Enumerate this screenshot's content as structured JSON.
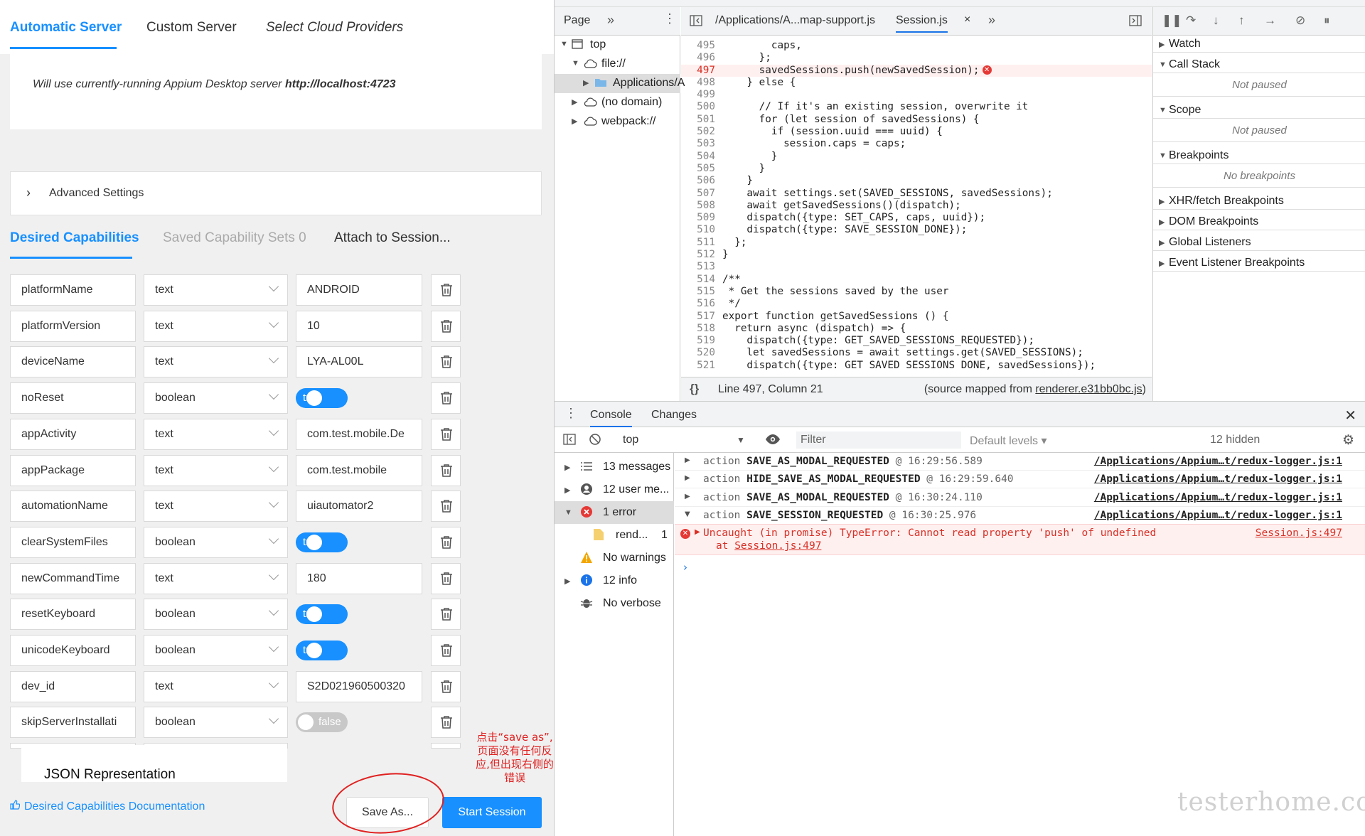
{
  "appium": {
    "server_tabs": [
      "Automatic Server",
      "Custom Server",
      "Select Cloud Providers"
    ],
    "server_note_prefix": "Will use currently-running Appium Desktop server ",
    "server_note_url": "http://localhost:4723",
    "advanced_settings_label": "Advanced Settings",
    "cap_tabs": [
      "Desired Capabilities",
      "Saved Capability Sets 0",
      "Attach to Session..."
    ],
    "capabilities": [
      {
        "name": "platformName",
        "type": "text",
        "value": "ANDROID"
      },
      {
        "name": "platformVersion",
        "type": "text",
        "value": "10"
      },
      {
        "name": "deviceName",
        "type": "text",
        "value": "LYA-AL00L"
      },
      {
        "name": "noReset",
        "type": "boolean",
        "value": "true"
      },
      {
        "name": "appActivity",
        "type": "text",
        "value": "com.test.mobile.De"
      },
      {
        "name": "appPackage",
        "type": "text",
        "value": "com.test.mobile"
      },
      {
        "name": "automationName",
        "type": "text",
        "value": "uiautomator2"
      },
      {
        "name": "clearSystemFiles",
        "type": "boolean",
        "value": "true"
      },
      {
        "name": "newCommandTime",
        "type": "text",
        "value": "180"
      },
      {
        "name": "resetKeyboard",
        "type": "boolean",
        "value": "true"
      },
      {
        "name": "unicodeKeyboard",
        "type": "boolean",
        "value": "true"
      },
      {
        "name": "dev_id",
        "type": "text",
        "value": "S2D021960500320"
      },
      {
        "name": "skipServerInstallati",
        "type": "boolean",
        "value": "false"
      }
    ],
    "json_representation_label": "JSON Representation",
    "docs_link_label": "Desired Capabilities Documentation",
    "save_as_label": "Save As...",
    "start_session_label": "Start Session",
    "annotation_text": "点击“save as”,页面没有任何反应,但出现右侧的错误",
    "accent_color": "#1890ff",
    "annotation_color": "#e02020"
  },
  "devtools": {
    "navigator": {
      "tab_label": "Page",
      "tree": [
        {
          "label": "top",
          "depth": 0,
          "expanded": true,
          "icon": "frame-icon"
        },
        {
          "label": "file://",
          "depth": 1,
          "expanded": true,
          "icon": "cloud-icon"
        },
        {
          "label": "Applications/A",
          "depth": 2,
          "expanded": false,
          "icon": "folder-icon",
          "selected": true
        },
        {
          "label": "(no domain)",
          "depth": 1,
          "expanded": false,
          "icon": "cloud-icon"
        },
        {
          "label": "webpack://",
          "depth": 1,
          "expanded": false,
          "icon": "cloud-icon"
        }
      ]
    },
    "editor": {
      "tabs": [
        "/Applications/A...map-support.js",
        "Session.js"
      ],
      "lines": [
        {
          "n": "495",
          "t": "        caps,"
        },
        {
          "n": "496",
          "t": "      };"
        },
        {
          "n": "497",
          "t": "      savedSessions.push(newSavedSession);",
          "error": true
        },
        {
          "n": "498",
          "t": "    } else {"
        },
        {
          "n": "499",
          "t": ""
        },
        {
          "n": "500",
          "t": "      // If it's an existing session, overwrite it"
        },
        {
          "n": "501",
          "t": "      for (let session of savedSessions) {"
        },
        {
          "n": "502",
          "t": "        if (session.uuid === uuid) {"
        },
        {
          "n": "503",
          "t": "          session.caps = caps;"
        },
        {
          "n": "504",
          "t": "        }"
        },
        {
          "n": "505",
          "t": "      }"
        },
        {
          "n": "506",
          "t": "    }"
        },
        {
          "n": "507",
          "t": "    await settings.set(SAVED_SESSIONS, savedSessions);"
        },
        {
          "n": "508",
          "t": "    await getSavedSessions()(dispatch);"
        },
        {
          "n": "509",
          "t": "    dispatch({type: SET_CAPS, caps, uuid});"
        },
        {
          "n": "510",
          "t": "    dispatch({type: SAVE_SESSION_DONE});"
        },
        {
          "n": "511",
          "t": "  };"
        },
        {
          "n": "512",
          "t": "}"
        },
        {
          "n": "513",
          "t": ""
        },
        {
          "n": "514",
          "t": "/**"
        },
        {
          "n": "515",
          "t": " * Get the sessions saved by the user"
        },
        {
          "n": "516",
          "t": " */"
        },
        {
          "n": "517",
          "t": "export function getSavedSessions () {"
        },
        {
          "n": "518",
          "t": "  return async (dispatch) => {"
        },
        {
          "n": "519",
          "t": "    dispatch({type: GET_SAVED_SESSIONS_REQUESTED});"
        },
        {
          "n": "520",
          "t": "    let savedSessions = await settings.get(SAVED_SESSIONS);"
        },
        {
          "n": "521",
          "t": "    dispatch({type: GET_SAVED_SESSIONS_DONE, savedSessions});"
        }
      ],
      "status_position": "Line 497, Column 21",
      "source_map_prefix": "(source mapped from ",
      "source_map_file": "renderer.e31bb0bc.js",
      "source_map_suffix": ")"
    },
    "debugger": {
      "panes": [
        {
          "label": "Watch",
          "expanded": false
        },
        {
          "label": "Call Stack",
          "expanded": true,
          "body": "Not paused"
        },
        {
          "label": "Scope",
          "expanded": true,
          "body": "Not paused"
        },
        {
          "label": "Breakpoints",
          "expanded": true,
          "body": "No breakpoints"
        },
        {
          "label": "XHR/fetch Breakpoints",
          "expanded": false
        },
        {
          "label": "DOM Breakpoints",
          "expanded": false
        },
        {
          "label": "Global Listeners",
          "expanded": false
        },
        {
          "label": "Event Listener Breakpoints",
          "expanded": false
        }
      ]
    },
    "drawer": {
      "tabs": [
        "Console",
        "Changes"
      ],
      "context": "top",
      "filter_placeholder": "Filter",
      "levels_label": "Default levels ▾",
      "hidden_label": "12 hidden",
      "sidebar": [
        {
          "label": "13 messages",
          "icon": "list-icon",
          "expandable": true
        },
        {
          "label": "12 user me...",
          "icon": "user-icon",
          "expandable": true
        },
        {
          "label": "1 error",
          "icon": "error-icon",
          "expandable": true,
          "selected": true,
          "expanded": true
        },
        {
          "label": "rend...",
          "count": "1",
          "icon": "file-icon",
          "child": true
        },
        {
          "label": "No warnings",
          "icon": "warning-icon",
          "expandable": false
        },
        {
          "label": "12 info",
          "icon": "info-icon",
          "expandable": true
        },
        {
          "label": "No verbose",
          "icon": "bug-icon",
          "expandable": false
        }
      ],
      "messages": [
        {
          "action": "SAVE_AS_MODAL_REQUESTED",
          "time": "16:29:56.589",
          "source": "/Applications/Appium…t/redux-logger.js:1"
        },
        {
          "action": "HIDE_SAVE_AS_MODAL_REQUESTED",
          "time": "16:29:59.640",
          "source": "/Applications/Appium…t/redux-logger.js:1"
        },
        {
          "action": "SAVE_AS_MODAL_REQUESTED",
          "time": "16:30:24.110",
          "source": "/Applications/Appium…t/redux-logger.js:1"
        },
        {
          "action": "SAVE_SESSION_REQUESTED",
          "time": "16:30:25.976",
          "source": "/Applications/Appium…t/redux-logger.js:1",
          "expanded": true
        }
      ],
      "action_word": "action",
      "at_sign": "@",
      "error": {
        "message": "Uncaught (in promise) TypeError: Cannot read property 'push' of undefined",
        "at_prefix": "at ",
        "at_link": "Session.js:497",
        "source": "Session.js:497"
      }
    }
  },
  "watermark": "testerhome.com"
}
